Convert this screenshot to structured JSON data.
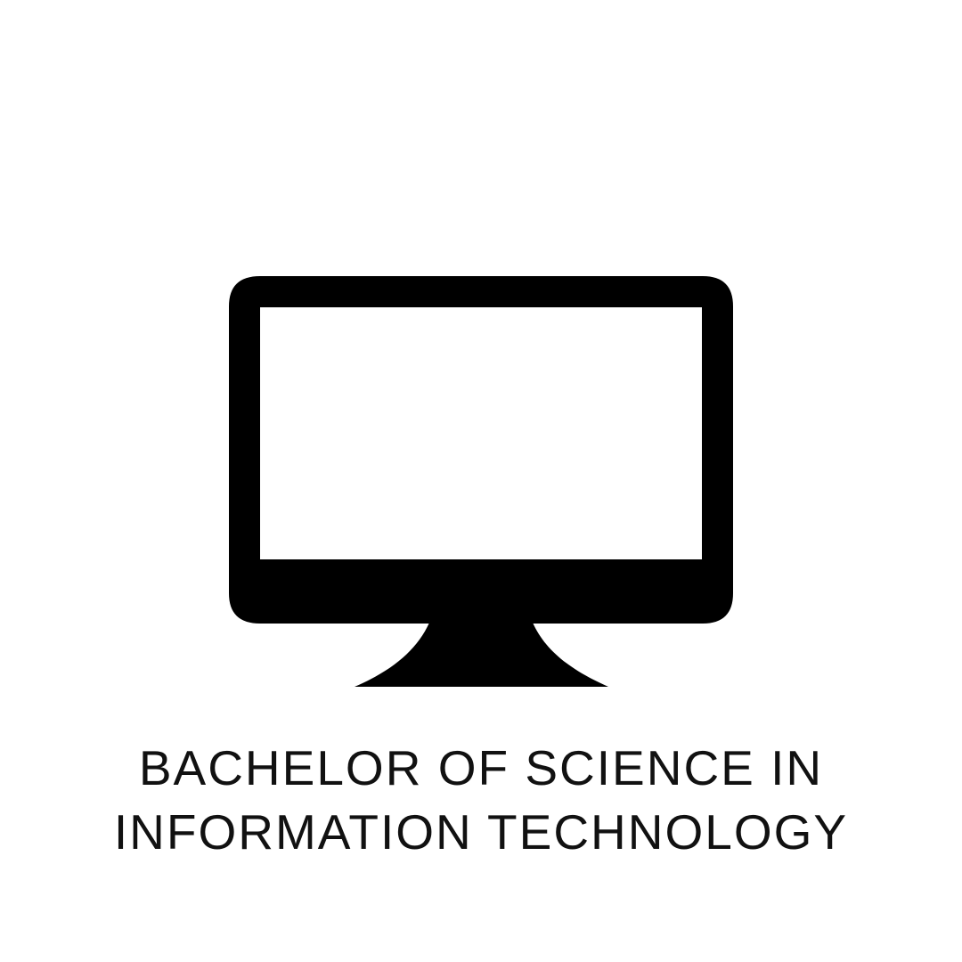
{
  "icon": {
    "name": "monitor-icon",
    "color": "#000000"
  },
  "title": {
    "line1": "BACHELOR OF SCIENCE IN",
    "line2": "INFORMATION TECHNOLOGY"
  }
}
